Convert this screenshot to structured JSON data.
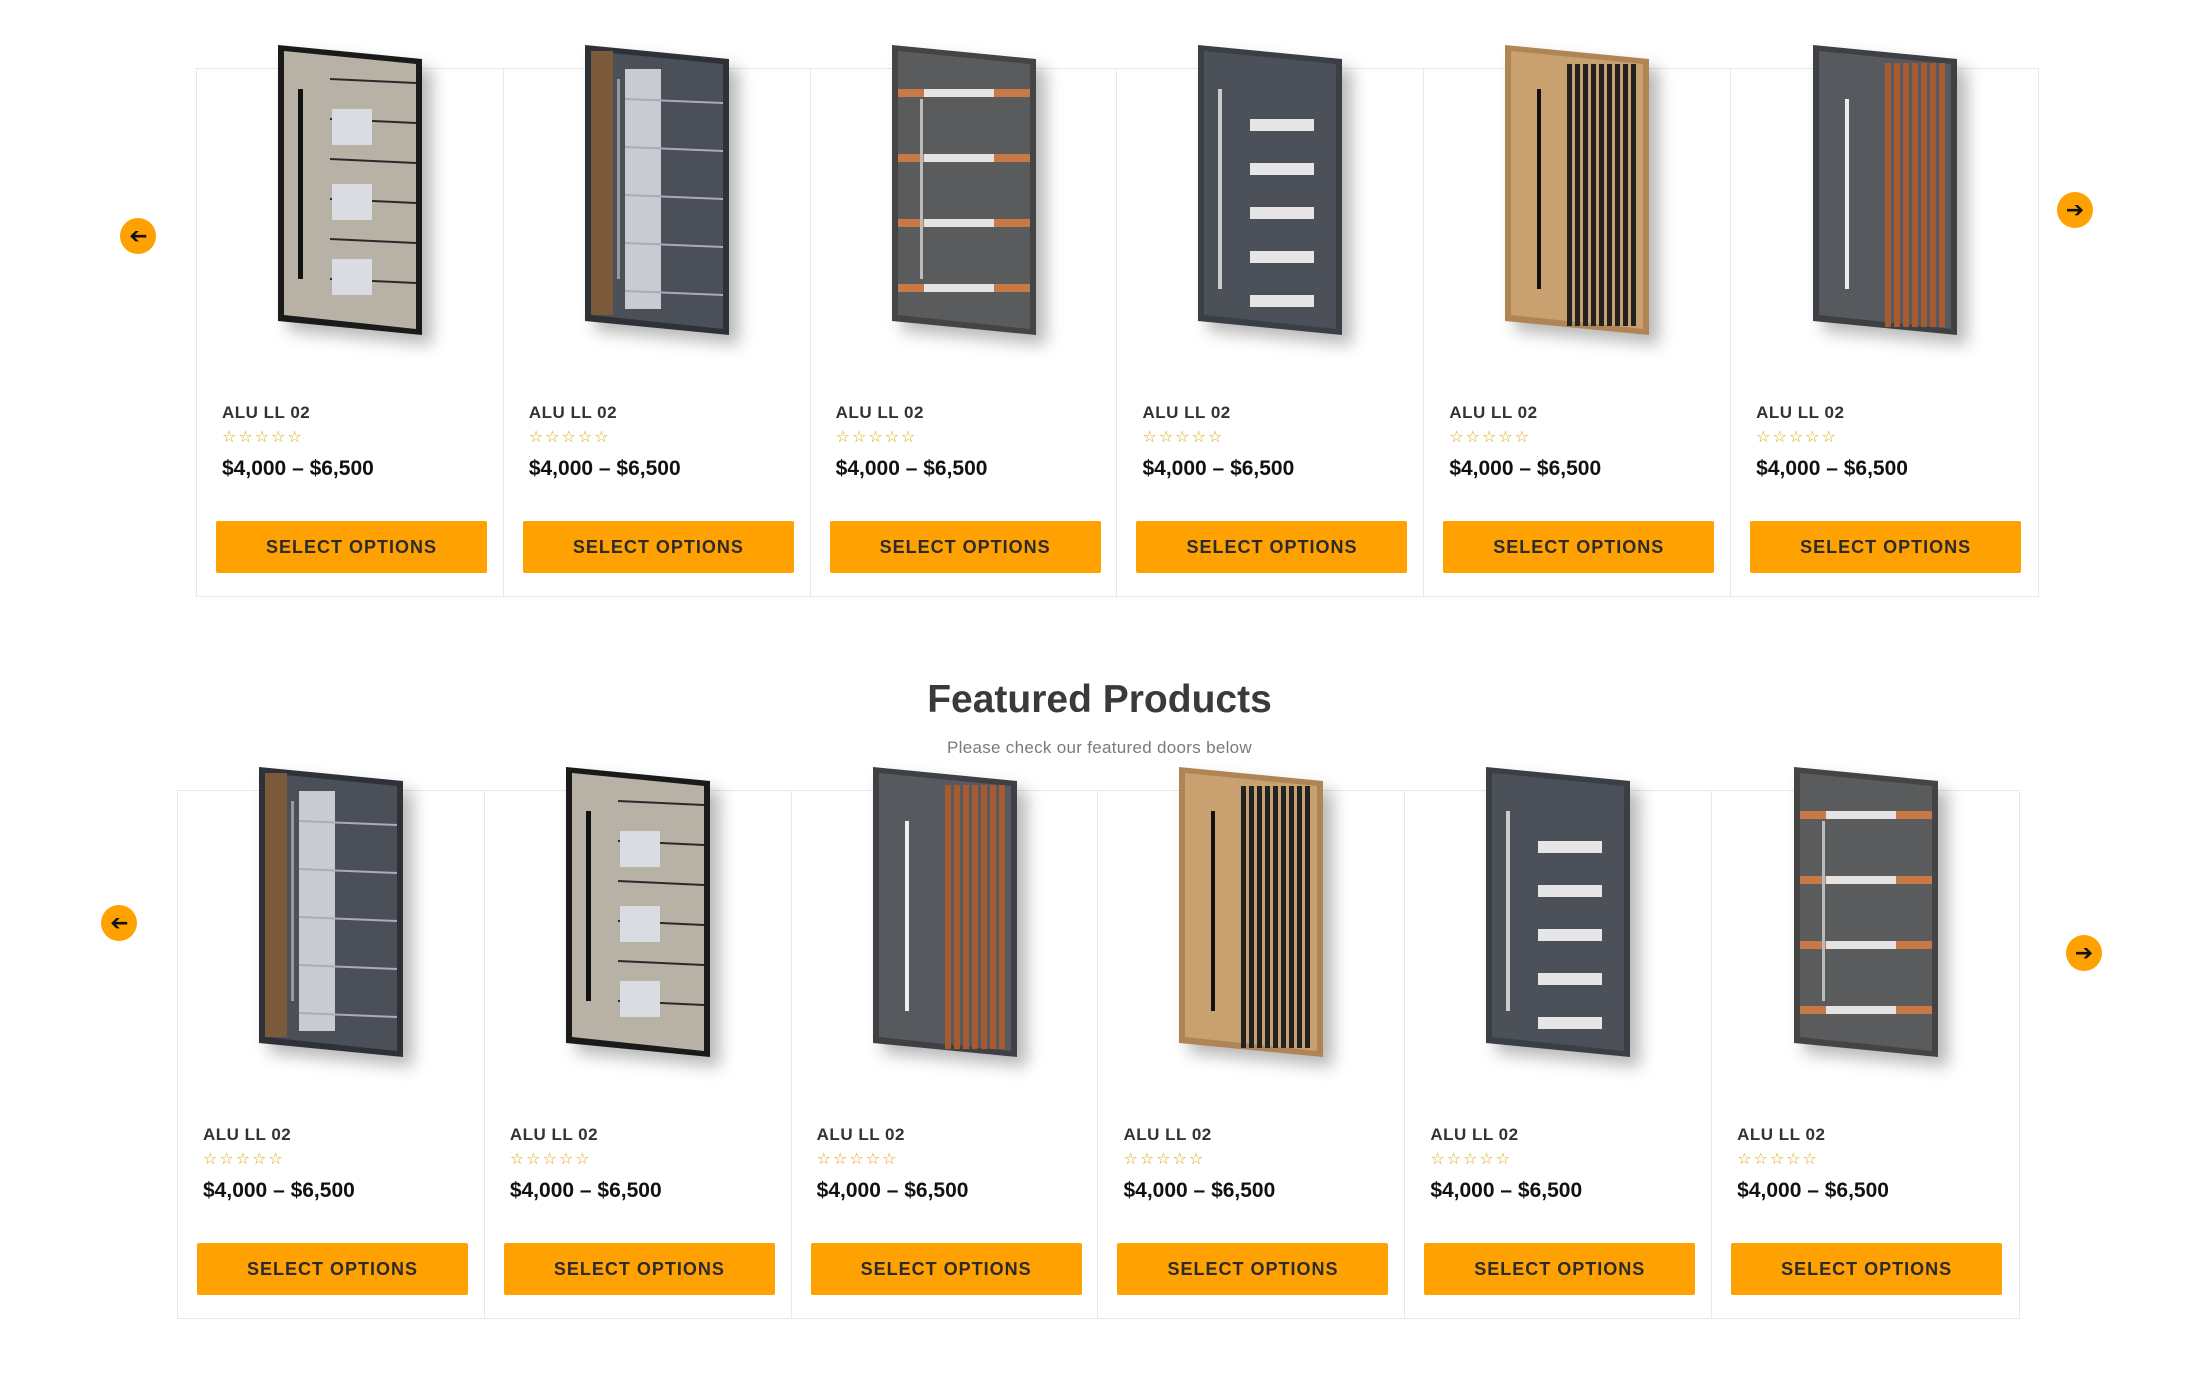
{
  "carousel_top": {
    "prev_icon": "arrow-left-icon",
    "next_icon": "arrow-right-icon",
    "products": [
      {
        "name": "ALU LL 02",
        "rating": "☆☆☆☆☆",
        "price": "$4,000 – $6,500",
        "button": "SELECT OPTIONS",
        "style": "oak-glass"
      },
      {
        "name": "ALU LL 02",
        "rating": "☆☆☆☆☆",
        "price": "$4,000 – $6,500",
        "button": "SELECT OPTIONS",
        "style": "grey-glass"
      },
      {
        "name": "ALU LL 02",
        "rating": "☆☆☆☆☆",
        "price": "$4,000 – $6,500",
        "button": "SELECT OPTIONS",
        "style": "grey-copper"
      },
      {
        "name": "ALU LL 02",
        "rating": "☆☆☆☆☆",
        "price": "$4,000 – $6,500",
        "button": "SELECT OPTIONS",
        "style": "anthracite-slots"
      },
      {
        "name": "ALU LL 02",
        "rating": "☆☆☆☆☆",
        "price": "$4,000 – $6,500",
        "button": "SELECT OPTIONS",
        "style": "wood-slats"
      },
      {
        "name": "ALU LL 02",
        "rating": "☆☆☆☆☆",
        "price": "$4,000 – $6,500",
        "button": "SELECT OPTIONS",
        "style": "grey-copper-slats"
      }
    ]
  },
  "featured": {
    "title": "Featured Products",
    "subtitle": "Please check our featured doors below",
    "prev_icon": "arrow-left-icon",
    "next_icon": "arrow-right-icon",
    "products": [
      {
        "name": "ALU LL 02",
        "rating": "☆☆☆☆☆",
        "price": "$4,000 – $6,500",
        "button": "SELECT OPTIONS",
        "style": "grey-glass"
      },
      {
        "name": "ALU LL 02",
        "rating": "☆☆☆☆☆",
        "price": "$4,000 – $6,500",
        "button": "SELECT OPTIONS",
        "style": "oak-glass"
      },
      {
        "name": "ALU LL 02",
        "rating": "☆☆☆☆☆",
        "price": "$4,000 – $6,500",
        "button": "SELECT OPTIONS",
        "style": "grey-copper-slats"
      },
      {
        "name": "ALU LL 02",
        "rating": "☆☆☆☆☆",
        "price": "$4,000 – $6,500",
        "button": "SELECT OPTIONS",
        "style": "wood-slats"
      },
      {
        "name": "ALU LL 02",
        "rating": "☆☆☆☆☆",
        "price": "$4,000 – $6,500",
        "button": "SELECT OPTIONS",
        "style": "anthracite-slots"
      },
      {
        "name": "ALU LL 02",
        "rating": "☆☆☆☆☆",
        "price": "$4,000 – $6,500",
        "button": "SELECT OPTIONS",
        "style": "grey-copper"
      }
    ]
  },
  "colors": {
    "accent": "#ffa100",
    "star": "#e0a21a",
    "border": "#e8e8e8"
  }
}
